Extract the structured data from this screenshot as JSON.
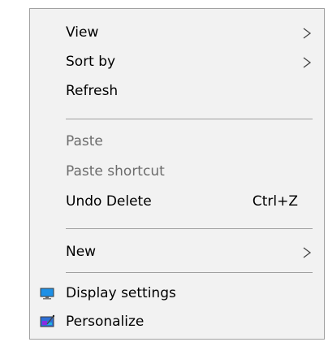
{
  "context_menu": {
    "items": [
      {
        "label": "View",
        "submenu": true,
        "enabled": true
      },
      {
        "label": "Sort by",
        "submenu": true,
        "enabled": true
      },
      {
        "label": "Refresh",
        "enabled": true
      },
      {
        "label": "Paste",
        "enabled": false
      },
      {
        "label": "Paste shortcut",
        "enabled": false
      },
      {
        "label": "Undo Delete",
        "shortcut": "Ctrl+Z",
        "enabled": true
      },
      {
        "label": "New",
        "submenu": true,
        "enabled": true
      },
      {
        "label": "Display settings",
        "icon": "display-settings-icon",
        "enabled": true
      },
      {
        "label": "Personalize",
        "icon": "personalize-icon",
        "enabled": true
      }
    ]
  },
  "colors": {
    "menu_background": "#f2f2f2",
    "menu_border": "#a0a0a0",
    "text": "#000000",
    "disabled_text": "#6d6d6d",
    "display_icon_blue": "#1e90e6",
    "personalize_icon_blue": "#2d6fd6"
  }
}
